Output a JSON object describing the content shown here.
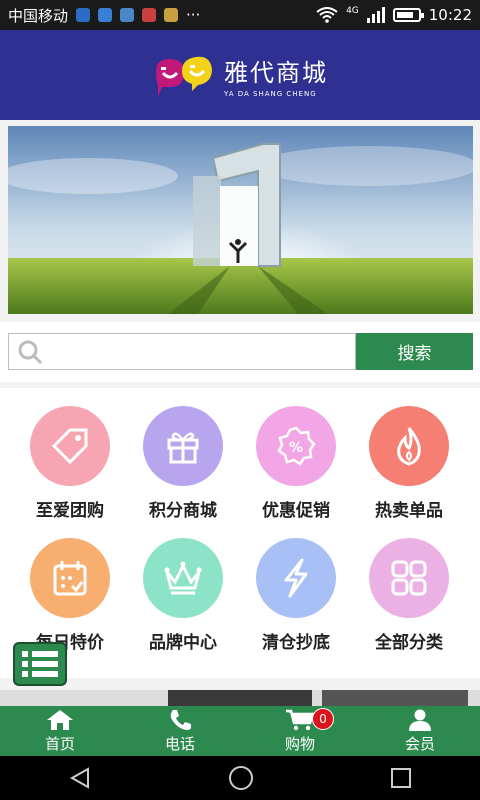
{
  "status": {
    "carrier": "中国移动",
    "network": "4G",
    "time": "10:22",
    "battery_level": 0.85
  },
  "header": {
    "brand_cn": "雅代商城",
    "brand_en": "YA DA SHANG CHENG"
  },
  "search": {
    "placeholder": "",
    "button_label": "搜索"
  },
  "categories": [
    {
      "label": "至爱团购",
      "icon": "tag-icon",
      "color": "#f7a5b3"
    },
    {
      "label": "积分商城",
      "icon": "gift-icon",
      "color": "#b7a6ee"
    },
    {
      "label": "优惠促销",
      "icon": "percent-badge-icon",
      "color": "#f2a6e6"
    },
    {
      "label": "热卖单品",
      "icon": "flame-icon",
      "color": "#f47f72"
    },
    {
      "label": "每日特价",
      "icon": "calendar-icon",
      "color": "#f7ae6f"
    },
    {
      "label": "品牌中心",
      "icon": "crown-icon",
      "color": "#8de3c8"
    },
    {
      "label": "清仓抄底",
      "icon": "lightning-icon",
      "color": "#a8c0f5"
    },
    {
      "label": "全部分类",
      "icon": "grid-icon",
      "color": "#ebb1e4"
    }
  ],
  "tabbar": {
    "home": "首页",
    "phone": "电话",
    "cart": "购物",
    "cart_count": "0",
    "member": "会员"
  },
  "colors": {
    "header_bg": "#2f3192",
    "accent_green": "#2d8a4f",
    "badge_red": "#d9141d"
  }
}
